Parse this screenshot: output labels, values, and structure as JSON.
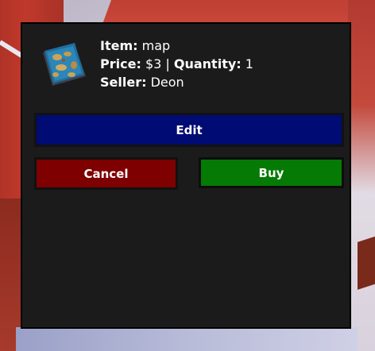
{
  "listing": {
    "item_label": "Item:",
    "item_value": "map",
    "price_label": "Price:",
    "price_value": "$3",
    "separator": "|",
    "quantity_label": "Quantity:",
    "quantity_value": "1",
    "seller_label": "Seller:",
    "seller_value": "Deon",
    "icon": "map-icon"
  },
  "buttons": {
    "edit_label": "Edit",
    "cancel_label": "Cancel",
    "buy_label": "Buy"
  },
  "colors": {
    "panel_bg": "#1b1b1b",
    "edit_bg": "#000b73",
    "cancel_bg": "#7e0000",
    "buy_bg": "#057a05",
    "text": "#ffffff"
  }
}
